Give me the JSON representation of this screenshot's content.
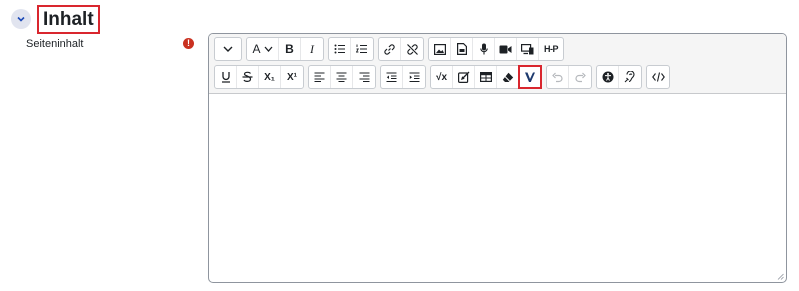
{
  "section": {
    "title": "Inhalt"
  },
  "field": {
    "label": "Seiteninhalt",
    "required_mark": "!"
  },
  "toolbar": {
    "expand_icon": "chevron-down-icon",
    "font_button_label": "A",
    "bold_label": "B",
    "italic_label": "I",
    "h5p_label": "H-P",
    "subscript_label": "X₁",
    "superscript_label": "X¹",
    "equation_label": "√x",
    "highlight_color": "#d9262e"
  },
  "content": {
    "text": ""
  }
}
